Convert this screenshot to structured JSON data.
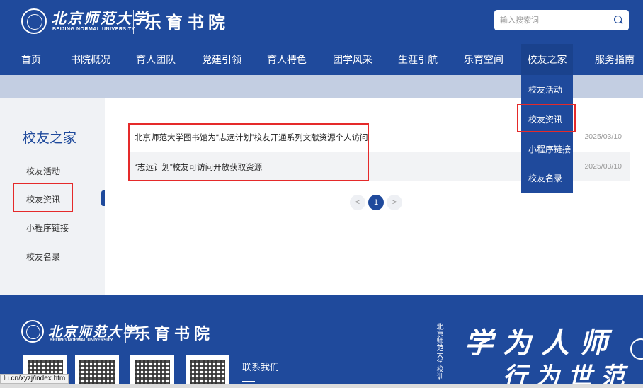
{
  "header": {
    "logo_cn": "北京师范大学",
    "logo_en": "BEIJING NORMAL UNIVERSITY",
    "logo_sub": "乐育书院",
    "search_placeholder": "输入搜索词"
  },
  "nav": {
    "items": [
      {
        "label": "首页"
      },
      {
        "label": "书院概况"
      },
      {
        "label": "育人团队"
      },
      {
        "label": "党建引领"
      },
      {
        "label": "育人特色"
      },
      {
        "label": "团学风采"
      },
      {
        "label": "生涯引航"
      },
      {
        "label": "乐育空间"
      },
      {
        "label": "校友之家"
      },
      {
        "label": "服务指南"
      }
    ]
  },
  "dropdown": {
    "items": [
      {
        "label": "校友活动"
      },
      {
        "label": "校友资讯"
      },
      {
        "label": "小程序链接"
      },
      {
        "label": "校友名录"
      }
    ]
  },
  "sidebar": {
    "title": "校友之家",
    "items": [
      {
        "label": "校友活动"
      },
      {
        "label": "校友资讯"
      },
      {
        "label": "小程序链接"
      },
      {
        "label": "校友名录"
      }
    ]
  },
  "news": [
    {
      "title": "北京师范大学图书馆为“志远计划”校友开通系列文献资源个人访问",
      "date": "2025/03/10"
    },
    {
      "title": "“志远计划”校友可访问开放获取资源",
      "date": "2025/03/10"
    }
  ],
  "pagination": {
    "prev": "<",
    "current": "1",
    "next": ">"
  },
  "footer": {
    "logo_cn": "北京师范大学",
    "logo_en": "BEIJING NORMAL UNIVERSITY",
    "logo_sub": "乐育书院",
    "contact": "联系我们",
    "calligraphy_line1": "学为人师",
    "calligraphy_line2": "行为世范"
  },
  "status_url": "lu.cn/xyzj/index.htm"
}
